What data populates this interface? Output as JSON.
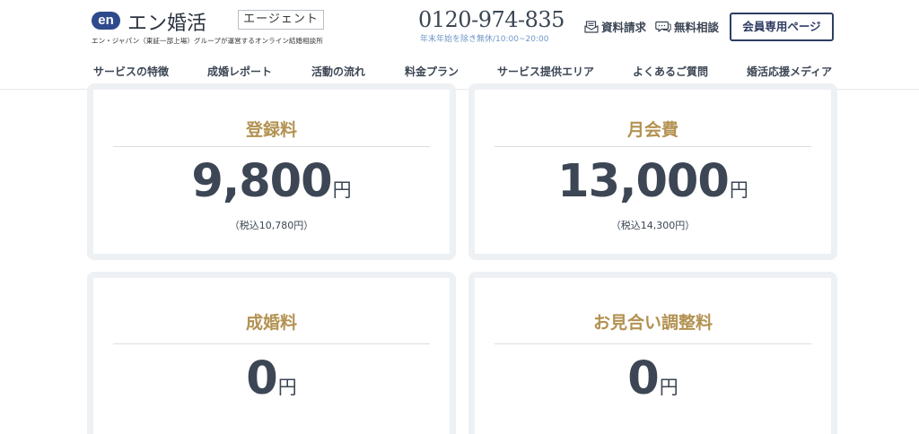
{
  "header": {
    "logo_badge": "en",
    "logo_title": "エン婚活",
    "logo_agent": "エージェント",
    "logo_sub": "エン・ジャパン（東証一部上場）グループが運営するオンライン結婚相談所",
    "phone": "0120-974-835",
    "phone_hours": "年末年始を除き無休/10:00~20:00",
    "docs_label": "資料請求",
    "consult_label": "無料相談",
    "member_label": "会員専用ページ"
  },
  "nav": {
    "items": [
      {
        "label": "サービスの特徴"
      },
      {
        "label": "成婚レポート"
      },
      {
        "label": "活動の流れ"
      },
      {
        "label": "料金プラン"
      },
      {
        "label": "サービス提供エリア"
      },
      {
        "label": "よくあるご質問"
      },
      {
        "label": "婚活応援メディア"
      }
    ]
  },
  "pricing": {
    "registration": {
      "title": "登録料",
      "amount": "9,800",
      "unit": "円",
      "tax": "（税込10,780円）"
    },
    "monthly": {
      "title": "月会費",
      "amount": "13,000",
      "unit": "円",
      "tax": "（税込14,300円）"
    },
    "marriage": {
      "title": "成婚料",
      "amount": "0",
      "unit": "円"
    },
    "matching": {
      "title": "お見合い調整料",
      "amount": "0",
      "unit": "円"
    }
  },
  "colors": {
    "accent_gold": "#b39252",
    "text_dark": "#3c4654",
    "navy": "#2e3d63",
    "card_border": "#eef1f4"
  },
  "icons": {
    "docs": "document-mail-icon",
    "consult": "chat-bubble-icon"
  }
}
